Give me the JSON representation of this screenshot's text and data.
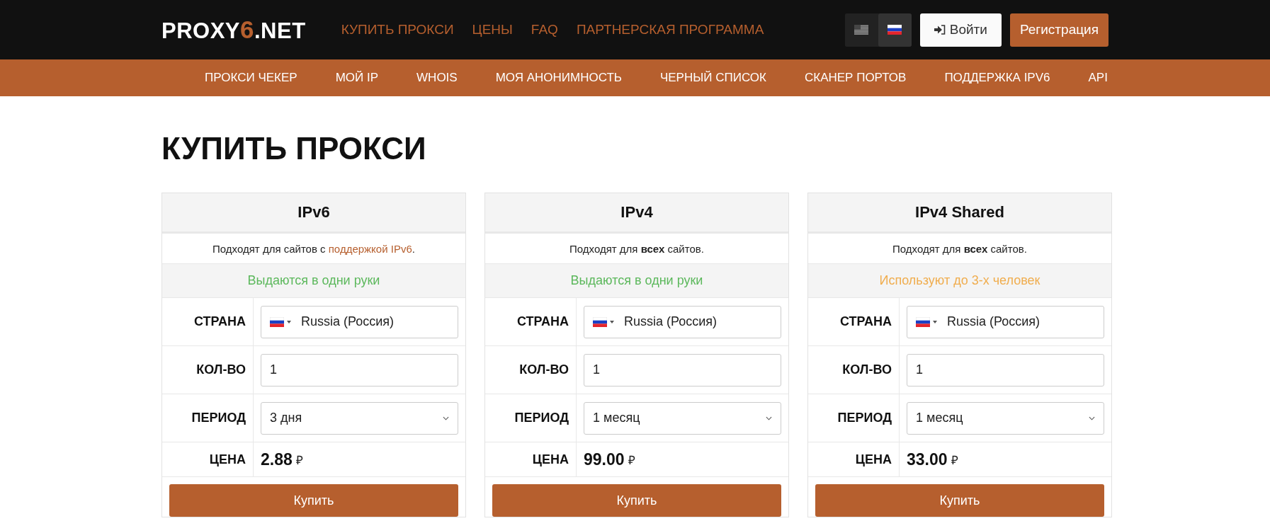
{
  "header": {
    "logo": {
      "before": "PROXY",
      "accent": "6",
      "after": ".NET"
    },
    "nav": [
      "КУПИТЬ ПРОКСИ",
      "ЦЕНЫ",
      "FAQ",
      "ПАРТНЕРСКАЯ ПРОГРАММА"
    ],
    "languages": [
      {
        "kind": "us",
        "selected": false
      },
      {
        "kind": "ru",
        "selected": true
      }
    ],
    "login_button": "Войти",
    "register_button": "Регистрация"
  },
  "tools_nav": [
    "ПРОКСИ ЧЕКЕР",
    "МОЙ IP",
    "WHOIS",
    "МОЯ АНОНИМНОСТЬ",
    "ЧЕРНЫЙ СПИСОК",
    "СКАНЕР ПОРТОВ",
    "ПОДДЕРЖКА IPV6",
    "API"
  ],
  "page_title": "КУПИТЬ ПРОКСИ",
  "cards": [
    {
      "title": "IPv6",
      "description": {
        "kind": "link",
        "before": "Подходят для сайтов с ",
        "link": "поддержкой IPv6",
        "after": "."
      },
      "note": {
        "text": "Выдаются в одни руки",
        "color": "#5cb85c"
      },
      "country": {
        "label": "СТРАНА",
        "value": "Russia (Россия)"
      },
      "quantity": {
        "label": "КОЛ-ВО",
        "value": "1"
      },
      "period": {
        "label": "ПЕРИОД",
        "value": "3 дня"
      },
      "price": {
        "label": "ЦЕНА",
        "amount": "2.88",
        "currency": "₽"
      },
      "buy_button": "Купить"
    },
    {
      "title": "IPv4",
      "description": {
        "kind": "plain",
        "text": "Подходят для **всех** сайтов."
      },
      "note": {
        "text": "Выдаются в одни руки",
        "color": "#5cb85c"
      },
      "country": {
        "label": "СТРАНА",
        "value": "Russia (Россия)"
      },
      "quantity": {
        "label": "КОЛ-ВО",
        "value": "1"
      },
      "period": {
        "label": "ПЕРИОД",
        "value": "1 месяц"
      },
      "price": {
        "label": "ЦЕНА",
        "amount": "99.00",
        "currency": "₽"
      },
      "buy_button": "Купить"
    },
    {
      "title": "IPv4 Shared",
      "description": {
        "kind": "plain",
        "text": "Подходят для **всех** сайтов."
      },
      "note": {
        "text": "Используют до 3-х человек",
        "color": "#f0ad4e"
      },
      "country": {
        "label": "СТРАНА",
        "value": "Russia (Россия)"
      },
      "quantity": {
        "label": "КОЛ-ВО",
        "value": "1"
      },
      "period": {
        "label": "ПЕРИОД",
        "value": "1 месяц"
      },
      "price": {
        "label": "ЦЕНА",
        "amount": "33.00",
        "currency": "₽"
      },
      "buy_button": "Купить"
    }
  ]
}
